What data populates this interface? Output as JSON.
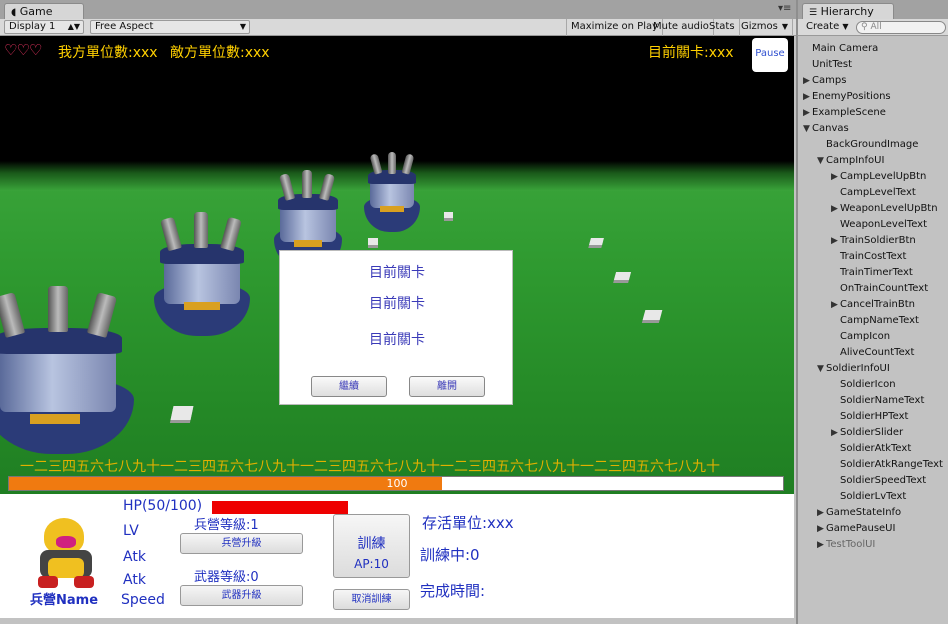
{
  "game_tab": {
    "icon": "pacman-icon",
    "label": "Game"
  },
  "game_toolbar": {
    "display": "Display 1",
    "aspect": "Free Aspect",
    "maximize": "Maximize on Play",
    "mute": "Mute audio",
    "stats": "Stats",
    "gizmos": "Gizmos"
  },
  "hud": {
    "hearts": "♡♡♡",
    "ally_units": "我方單位數:xxx",
    "enemy_units": "敵方單位數:xxx",
    "current_level": "目前關卡:xxx",
    "pause": "Pause"
  },
  "dialog": {
    "line1": "目前關卡",
    "line2": "目前關卡",
    "line3": "目前關卡",
    "continue": "繼續",
    "leave": "離開"
  },
  "marquee": "一二三四五六七八九十一二三四五六七八九十一二三四五六七八九十一二三四五六七八九十一二三四五六七八九十",
  "progress": {
    "value": 100,
    "fill_fraction": 0.56,
    "label": "100"
  },
  "soldier_panel": {
    "hp": "HP(50/100)",
    "hp_fraction": 0.5,
    "lv": "LV",
    "atk1": "Atk",
    "atk2": "Atk",
    "speed": "Speed",
    "name": "兵營Name",
    "camp_level": "兵營等級:1",
    "camp_upgrade": "兵營升級",
    "weapon_level": "武器等級:0",
    "weapon_upgrade": "武器升級",
    "train": "訓練",
    "ap": "AP:10",
    "cancel_train": "取消訓練",
    "alive": "存活單位:xxx",
    "training": "訓練中:0",
    "finish_time": "完成時間:"
  },
  "hierarchy": {
    "tab": "Hierarchy",
    "create": "Create",
    "search_placeholder": "All",
    "items": [
      {
        "label": "Main Camera",
        "depth": 0,
        "arrow": ""
      },
      {
        "label": "UnitTest",
        "depth": 0,
        "arrow": ""
      },
      {
        "label": "Camps",
        "depth": 0,
        "arrow": "▶"
      },
      {
        "label": "EnemyPositions",
        "depth": 0,
        "arrow": "▶"
      },
      {
        "label": "ExampleScene",
        "depth": 0,
        "arrow": "▶"
      },
      {
        "label": "Canvas",
        "depth": 0,
        "arrow": "▼"
      },
      {
        "label": "BackGroundImage",
        "depth": 1,
        "arrow": ""
      },
      {
        "label": "CampInfoUI",
        "depth": 1,
        "arrow": "▼"
      },
      {
        "label": "CampLevelUpBtn",
        "depth": 2,
        "arrow": "▶"
      },
      {
        "label": "CampLevelText",
        "depth": 2,
        "arrow": ""
      },
      {
        "label": "WeaponLevelUpBtn",
        "depth": 2,
        "arrow": "▶"
      },
      {
        "label": "WeaponLevelText",
        "depth": 2,
        "arrow": ""
      },
      {
        "label": "TrainSoldierBtn",
        "depth": 2,
        "arrow": "▶"
      },
      {
        "label": "TrainCostText",
        "depth": 2,
        "arrow": ""
      },
      {
        "label": "TrainTimerText",
        "depth": 2,
        "arrow": ""
      },
      {
        "label": "OnTrainCountText",
        "depth": 2,
        "arrow": ""
      },
      {
        "label": "CancelTrainBtn",
        "depth": 2,
        "arrow": "▶"
      },
      {
        "label": "CampNameText",
        "depth": 2,
        "arrow": ""
      },
      {
        "label": "CampIcon",
        "depth": 2,
        "arrow": ""
      },
      {
        "label": "AliveCountText",
        "depth": 2,
        "arrow": ""
      },
      {
        "label": "SoldierInfoUI",
        "depth": 1,
        "arrow": "▼"
      },
      {
        "label": "SoldierIcon",
        "depth": 2,
        "arrow": ""
      },
      {
        "label": "SoldierNameText",
        "depth": 2,
        "arrow": ""
      },
      {
        "label": "SoldierHPText",
        "depth": 2,
        "arrow": ""
      },
      {
        "label": "SoldierSlider",
        "depth": 2,
        "arrow": "▶"
      },
      {
        "label": "SoldierAtkText",
        "depth": 2,
        "arrow": ""
      },
      {
        "label": "SoldierAtkRangeText",
        "depth": 2,
        "arrow": ""
      },
      {
        "label": "SoldierSpeedText",
        "depth": 2,
        "arrow": ""
      },
      {
        "label": "SoldierLvText",
        "depth": 2,
        "arrow": ""
      },
      {
        "label": "GameStateInfo",
        "depth": 1,
        "arrow": "▶"
      },
      {
        "label": "GamePauseUI",
        "depth": 1,
        "arrow": "▶"
      },
      {
        "label": "TestToolUI",
        "depth": 1,
        "arrow": "▶",
        "disabled": true
      }
    ]
  }
}
